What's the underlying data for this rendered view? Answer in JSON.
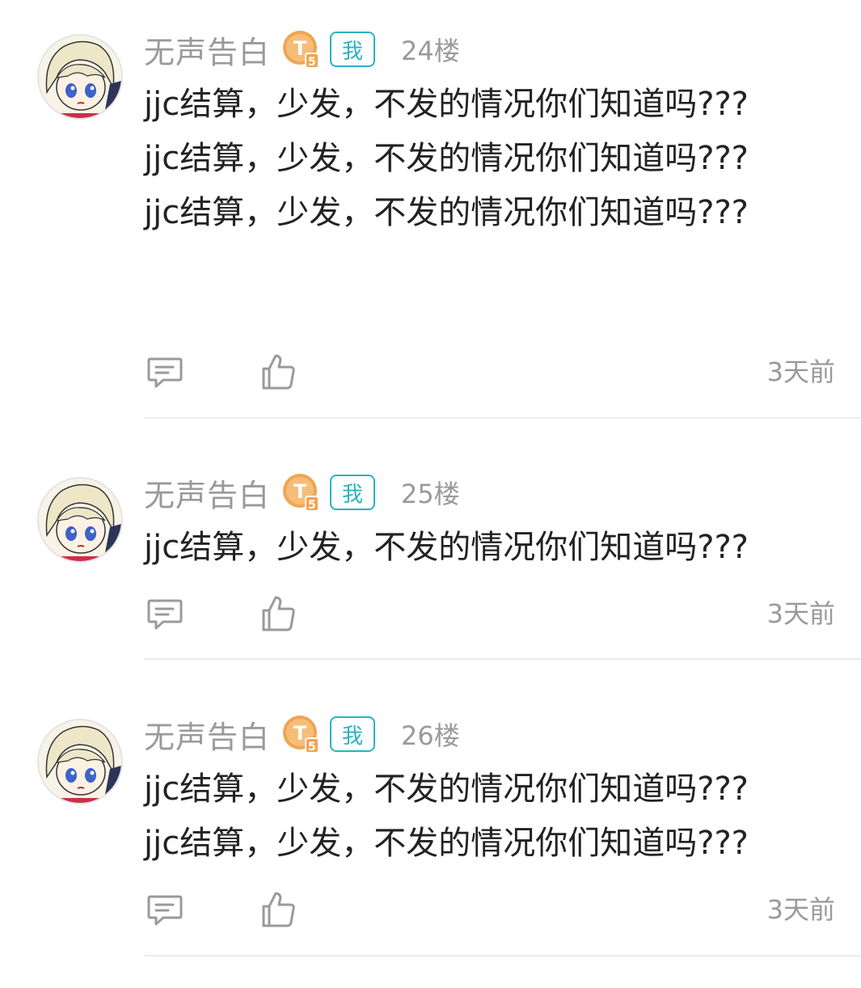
{
  "posts": [
    {
      "username": "无声告白",
      "level_badge": "T5",
      "me_badge": "我",
      "floor": "24楼",
      "lines": [
        "jjc结算，少发，不发的情况你们知道吗???",
        "jjc结算，少发，不发的情况你们知道吗???",
        "jjc结算，少发，不发的情况你们知道吗???"
      ],
      "time": "3天前",
      "icons": {
        "comment": "comment-icon",
        "like": "thumbs-up-icon"
      }
    },
    {
      "username": "无声告白",
      "level_badge": "T5",
      "me_badge": "我",
      "floor": "25楼",
      "lines": [
        "jjc结算，少发，不发的情况你们知道吗???"
      ],
      "time": "3天前",
      "icons": {
        "comment": "comment-icon",
        "like": "thumbs-up-icon"
      }
    },
    {
      "username": "无声告白",
      "level_badge": "T5",
      "me_badge": "我",
      "floor": "26楼",
      "lines": [
        "jjc结算，少发，不发的情况你们知道吗???",
        "jjc结算，少发，不发的情况你们知道吗???"
      ],
      "time": "3天前",
      "icons": {
        "comment": "comment-icon",
        "like": "thumbs-up-icon"
      }
    }
  ],
  "colors": {
    "meta_gray": "#9a9a9a",
    "text": "#222222",
    "accent_teal": "#2ab3bf",
    "badge_orange": "#f0a552",
    "divider": "#eeeeee"
  }
}
